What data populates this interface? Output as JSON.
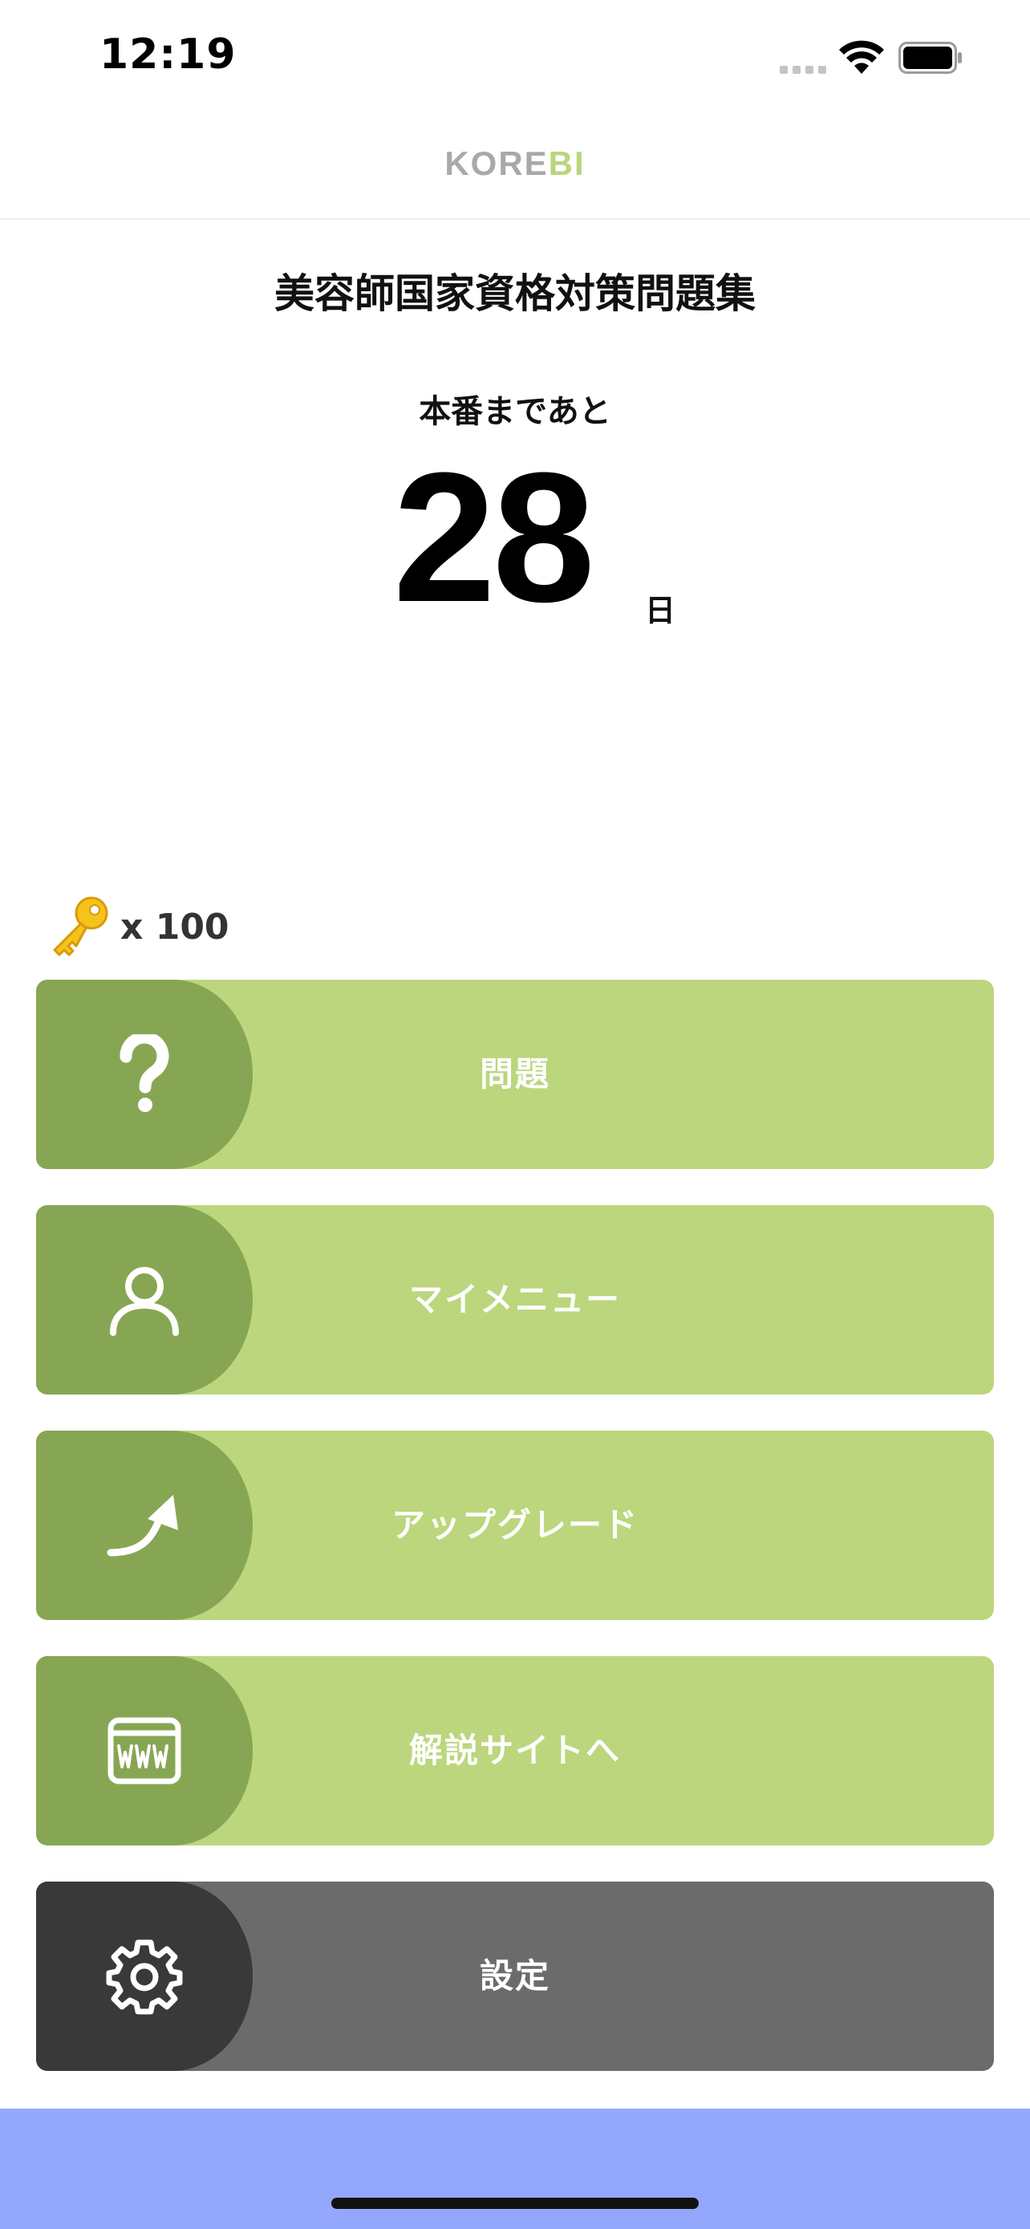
{
  "status_bar": {
    "time": "12:19"
  },
  "header": {
    "brand_part1": "KORE",
    "brand_part2": "BI"
  },
  "main": {
    "title": "美容師国家資格対策問題集",
    "countdown_label": "本番まであと",
    "days_remaining": "28",
    "days_unit": "日"
  },
  "keys": {
    "count_label": "x 100"
  },
  "menu": {
    "items": [
      {
        "label": "問題",
        "icon": "question-icon"
      },
      {
        "label": "マイメニュー",
        "icon": "person-icon"
      },
      {
        "label": "アップグレード",
        "icon": "curved-arrow-icon"
      },
      {
        "label": "解説サイトへ",
        "icon": "www-icon"
      },
      {
        "label": "設定",
        "icon": "gear-icon"
      }
    ]
  },
  "colors": {
    "menu_green": "#bbd67d",
    "menu_green_dark": "#87a653",
    "menu_gray": "#6b6b6b",
    "menu_gray_dark": "#393939",
    "brand_gray": "#a9a9a9",
    "brand_green": "#b9d67b",
    "bottom_band": "#93a8fd"
  }
}
